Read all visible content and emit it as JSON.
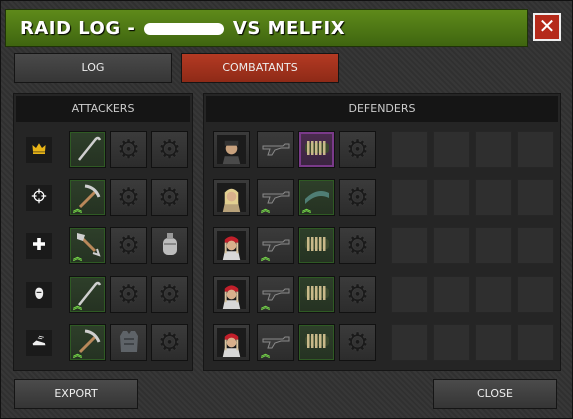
{
  "window": {
    "title_prefix": "RAID LOG -",
    "title_suffix": "VS MELFIX",
    "close_symbol": "✕"
  },
  "tabs": [
    {
      "label": "LOG",
      "active": false
    },
    {
      "label": "COMBATANTS",
      "active": true
    }
  ],
  "attackers": {
    "header": "ATTACKERS",
    "rows": [
      {
        "role": "crown-icon",
        "slots": [
          "crowbar-icon",
          "gear-icon",
          "gear-icon"
        ]
      },
      {
        "role": "crosshair-icon",
        "slots": [
          "pickaxe-icon",
          "gear-icon",
          "gear-icon"
        ]
      },
      {
        "role": "medic-cross-icon",
        "slots": [
          "shovel-icon",
          "gear-icon",
          "canteen-icon"
        ]
      },
      {
        "role": "stealth-icon",
        "slots": [
          "crowbar-icon",
          "gear-icon",
          "gear-icon"
        ]
      },
      {
        "role": "running-shoe-icon",
        "slots": [
          "pickaxe-icon",
          "body-armor-icon",
          "gear-icon"
        ]
      }
    ]
  },
  "defenders": {
    "header": "DEFENDERS",
    "rows": [
      {
        "portrait": "soldier-portrait",
        "slots": [
          "shotgun-icon",
          "ammo-belt-icon",
          "gear-icon"
        ]
      },
      {
        "portrait": "blonde-survivor-portrait",
        "slots": [
          "shotgun-icon",
          "ammo-clip-icon",
          "gear-icon"
        ]
      },
      {
        "portrait": "red-bandana-portrait",
        "slots": [
          "shotgun-icon",
          "ammo-belt-icon",
          "gear-icon"
        ]
      },
      {
        "portrait": "red-bandana-portrait",
        "slots": [
          "shotgun-icon",
          "ammo-belt-icon",
          "gear-icon"
        ]
      },
      {
        "portrait": "red-bandana-portrait",
        "slots": [
          "shotgun-icon",
          "ammo-belt-icon",
          "gear-icon"
        ]
      }
    ]
  },
  "buttons": {
    "export": "EXPORT",
    "close": "CLOSE"
  },
  "colors": {
    "title_green": "#4f7a16",
    "active_tab_red": "#a3321d",
    "close_red": "#b52a1a",
    "upgrade_chevron": "#79e04a"
  }
}
